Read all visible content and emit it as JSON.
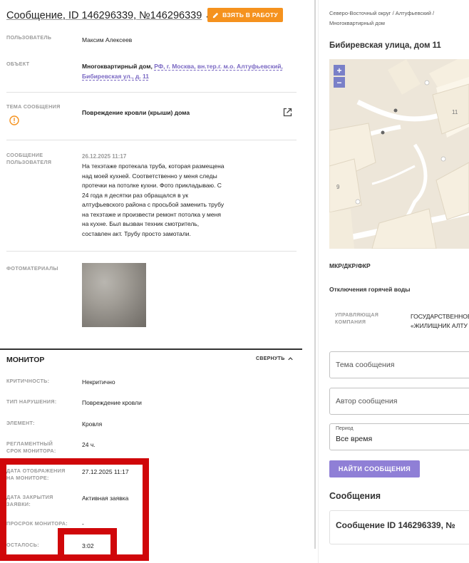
{
  "message": {
    "title": "Сообщение, ID 146296339, №146296339",
    "take_button": "ВЗЯТЬ В РАБОТУ",
    "user_label": "ПОЛЬЗОВАТЕЛЬ",
    "user_value": "Максим Алексеев",
    "object_label": "ОБЪЕКТ",
    "object_type": "Многоквартирный дом,",
    "object_address_1": "РФ, г. Москва, вн.тер.г. м.о. Алтуфьевский,",
    "object_address_2": "Бибиревская ул., д. 11",
    "topic_label_1": "ТЕМА СООБЩЕНИЯ",
    "topic_value": "Повреждение кровли (крыши) дома",
    "msg_label_1": "СООБЩЕНИЕ",
    "msg_label_2": "ПОЛЬЗОВАТЕЛЯ",
    "msg_date": "26.12.2025 11:17",
    "msg_lines": [
      "На техэтаже протекала труба, которая размещена",
      "над моей кухней. Соответственно у меня следы",
      "протечки на потолке кухни. Фото прикладываю. С",
      "24 года я десятки раз обращался в ук",
      "алтуфьевского района с просьбой заменить трубу",
      "на техэтаже и произвести ремонт потолка у меня",
      "на кухне. Был вызван техник смотритель,",
      "составлен акт. Трубу просто замотали."
    ],
    "photos_label": "ФОТОМАТЕРИАЛЫ"
  },
  "monitor": {
    "title": "МОНИТОР",
    "collapse": "СВЕРНУТЬ",
    "criticality_label": "КРИТИЧНОСТЬ:",
    "criticality_value": "Некритично",
    "violation_label": "ТИП НАРУШЕНИЯ:",
    "violation_value": "Повреждение кровли",
    "element_label": "ЭЛЕМЕНТ:",
    "element_value": "Кровля",
    "reg_label_1": "РЕГЛАМЕНТНЫЙ",
    "reg_label_2": "СРОК МОНИТОРА:",
    "reg_value": "24 ч.",
    "display_label_1": "ДАТА ОТОБРАЖЕНИЯ",
    "display_label_2": "НА МОНИТОРЕ:",
    "display_value": "27.12.2025 11:17",
    "close_label_1": "ДАТА ЗАКРЫТИЯ",
    "close_label_2": "ЗАЯВКИ:",
    "close_value": "Активная заявка",
    "overdue_label": "ПРОСРОК МОНИТОРА:",
    "overdue_value": "-",
    "remaining_label": "ОСТАЛОСЬ:",
    "remaining_value": "3:02"
  },
  "side": {
    "breadcrumb_1": "Северо-Восточный округ / Алтуфьевский /",
    "breadcrumb_2": "Многоквартирный дом",
    "address": "Бибиревская улица, дом 11",
    "zoom_in": "+",
    "zoom_out": "−",
    "map_label_11": "11",
    "map_label_9": "9",
    "programs": "МКР/ДКР/ФКР",
    "hot_water": "Отключения горячей воды",
    "mgmt_label_1": "УПРАВЛЯЮЩАЯ",
    "mgmt_label_2": "КОМПАНИЯ",
    "mgmt_value_1": "ГОСУДАРСТВЕННОЕ",
    "mgmt_value_2": "«ЖИЛИЩНИК АЛТУ",
    "topic_placeholder": "Тема сообщения",
    "author_placeholder": "Автор сообщения",
    "period_label": "Период",
    "period_value": "Все время",
    "find_button": "НАЙТИ СООБЩЕНИЯ",
    "messages_title": "Сообщения",
    "message_card": "Сообщение ID 146296339, №"
  },
  "colors": {
    "accent_orange": "#f5921e",
    "accent_purple": "#8f7fd6",
    "highlight_red": "#d0070a"
  }
}
